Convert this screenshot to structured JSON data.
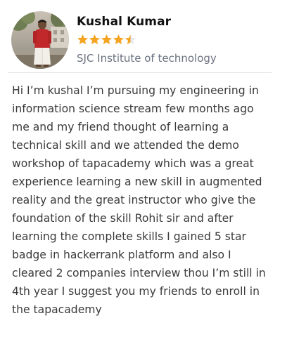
{
  "reviewer": {
    "name": "Kushal Kumar",
    "college": "SJC Institute of technology",
    "rating": 4.5,
    "rating_max": 5,
    "star_color": "#f5a524",
    "avatar_icon": "person-photo-icon"
  },
  "review": {
    "text": "Hi I’m kushal I’m pursuing my engineering in information science stream few months ago me and my friend thought of learning a technical skill and we attended the demo workshop of tapacademy which was a great experience learning a new skill in augmented reality and the great instructor who give the foundation of the skill Rohit sir and after learning the complete skills I gained 5 star badge in hackerrank platform and also I cleared 2 companies interview thou I’m still in 4th year I suggest you my friends to enroll in the tapacademy"
  }
}
